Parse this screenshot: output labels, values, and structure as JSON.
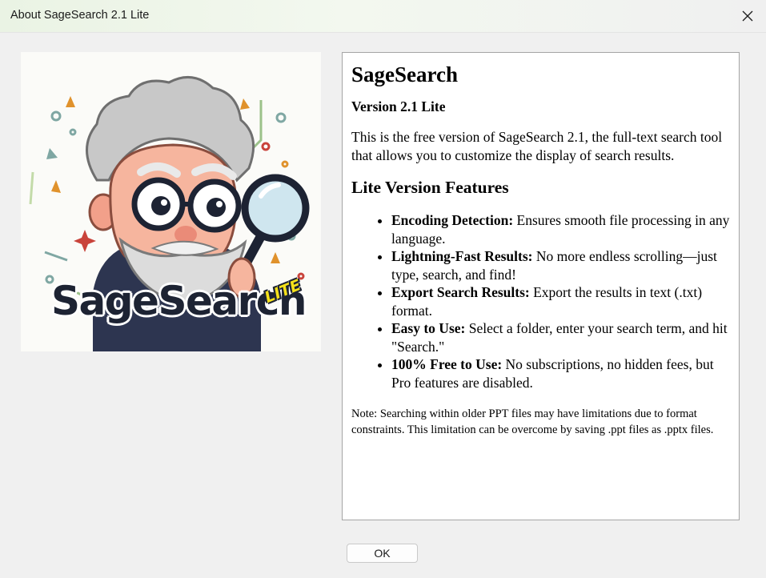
{
  "window": {
    "title": "About SageSearch 2.1 Lite",
    "close_icon": "close-icon"
  },
  "logo": {
    "wordmark": "SageSearch",
    "badge": "LITE",
    "icon": "sage-mascot-magnifier-logo"
  },
  "about": {
    "app_name": "SageSearch",
    "version": "Version 2.1 Lite",
    "description": "This is the free version of SageSearch 2.1, the full-text search tool that allows you to customize the display of search results.",
    "features_heading": "Lite Version Features",
    "features": [
      {
        "title": "Encoding Detection:",
        "text": " Ensures smooth file processing in any language."
      },
      {
        "title": "Lightning-Fast Results:",
        "text": " No more endless scrolling—just type, search, and find!"
      },
      {
        "title": "Export Search Results:",
        "text": " Export the results in text (.txt) format."
      },
      {
        "title": "Easy to Use:",
        "text": " Select a folder, enter your search term, and hit \"Search.\""
      },
      {
        "title": "100% Free to Use:",
        "text": " No subscriptions, no hidden fees, but Pro features are disabled."
      }
    ],
    "note": "Note: Searching within older PPT files may have limitations due to format constraints. This limitation can be overcome by saving .ppt files as .pptx files."
  },
  "footer": {
    "ok_label": "OK"
  }
}
